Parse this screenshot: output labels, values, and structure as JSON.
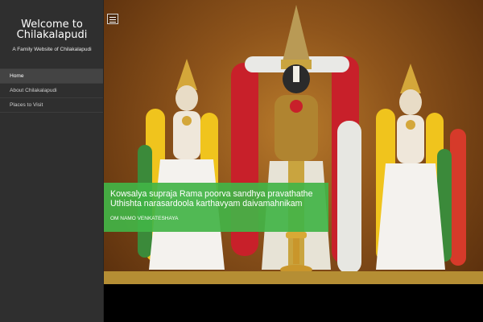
{
  "site": {
    "title_line1": "Welcome to",
    "title_line2": "Chilakalapudi",
    "description": "A Family Website of Chilakalapudi"
  },
  "nav": {
    "items": [
      {
        "label": "Home",
        "active": true
      },
      {
        "label": "About Chilakalapudi",
        "active": false
      },
      {
        "label": "Places to Visit",
        "active": false
      }
    ]
  },
  "slider": {
    "caption_line1": "Kowsalya supraja Rama poorva sandhya pravathathe",
    "caption_line2": "Uthishta narasardoola karthavyam daivamahnikam",
    "caption_sub": "OM NAMO VENKATESHAYA"
  },
  "menu_toggle": {
    "icon": "hamburger-icon"
  },
  "colors": {
    "sidebar": "#2f2f2f",
    "caption_bg": "#42b446",
    "hero_bg": "#8e541b"
  }
}
